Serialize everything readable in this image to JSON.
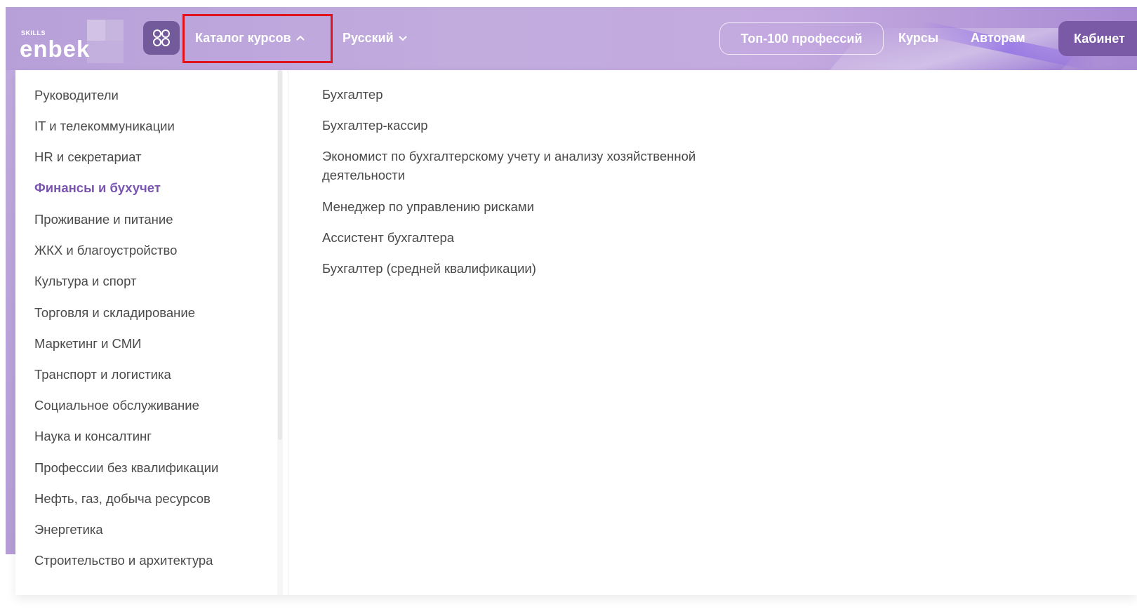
{
  "header": {
    "logo": {
      "skills": "SKILLS",
      "brand": "enbek"
    },
    "nav": {
      "catalog_label": "Каталог курсов",
      "language_label": "Русский",
      "top100_label": "Топ-100 профессий",
      "courses_label": "Курсы",
      "authors_label": "Авторам",
      "cabinet_label": "Кабинет"
    }
  },
  "categories": [
    {
      "label": "Руководители"
    },
    {
      "label": "IT и телекоммуникации"
    },
    {
      "label": "HR и секретариат"
    },
    {
      "label": "Финансы и бухучет",
      "active": true
    },
    {
      "label": "Проживание и питание"
    },
    {
      "label": "ЖКХ и благоустройство"
    },
    {
      "label": "Культура и спорт"
    },
    {
      "label": "Торговля и складирование"
    },
    {
      "label": "Маркетинг и СМИ"
    },
    {
      "label": "Транспорт и логистика"
    },
    {
      "label": "Социальное обслуживание"
    },
    {
      "label": "Наука и консалтинг"
    },
    {
      "label": "Профессии без квалификации"
    },
    {
      "label": "Нефть, газ, добыча ресурсов"
    },
    {
      "label": "Энергетика"
    },
    {
      "label": "Строительство и архитектура"
    }
  ],
  "professions": [
    {
      "label": "Бухгалтер"
    },
    {
      "label": "Бухгалтер-кассир"
    },
    {
      "label": "Экономист по бухгалтерскому учету и анализу хозяйственной деятельности"
    },
    {
      "label": "Менеджер по управлению рисками"
    },
    {
      "label": "Ассистент бухгалтера"
    },
    {
      "label": "Бухгалтер (средней квалификации)"
    }
  ],
  "colors": {
    "header_gradient_start": "#b7a0d8",
    "accent_purple": "#7a55b0",
    "cabinet_button": "#7a5aa6",
    "highlight_box": "#e0131c"
  }
}
